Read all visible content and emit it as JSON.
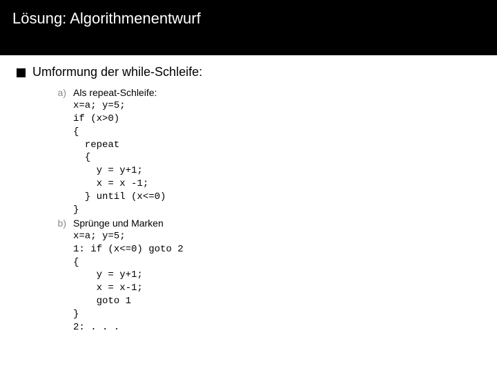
{
  "header": {
    "title": "Lösung: Algorithmenentwurf"
  },
  "bullet": {
    "text": "Umformung der while-Schleife:"
  },
  "items": [
    {
      "label": "a)",
      "heading": "Als repeat-Schleife:",
      "code": "x=a; y=5;\nif (x>0)\n{\n  repeat\n  {\n    y = y+1;\n    x = x -1;\n  } until (x<=0)\n}"
    },
    {
      "label": "b)",
      "heading": "Sprünge und Marken",
      "code": "x=a; y=5;\n1: if (x<=0) goto 2\n{\n    y = y+1;\n    x = x-1;\n    goto 1\n}\n2: . . ."
    }
  ]
}
